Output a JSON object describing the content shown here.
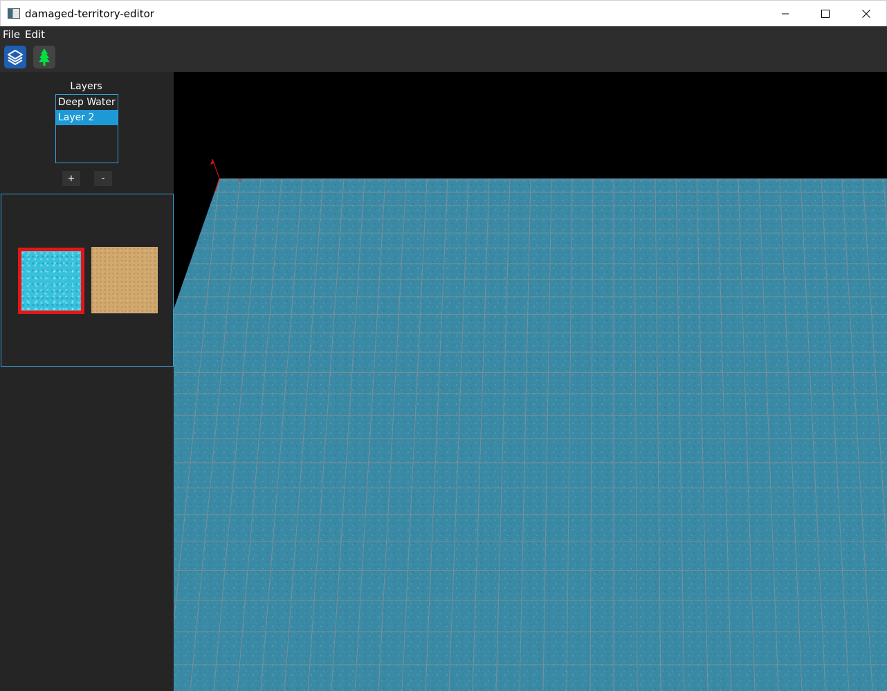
{
  "window": {
    "title": "damaged-territory-editor",
    "controls": [
      "minimize",
      "maximize",
      "close"
    ]
  },
  "menu": {
    "items": [
      {
        "label": "File"
      },
      {
        "label": "Edit"
      }
    ]
  },
  "toolbar": {
    "tools": [
      {
        "icon": "layers-icon",
        "active": true,
        "color": "#1e5fb3"
      },
      {
        "icon": "tree-icon",
        "active": false,
        "color": "#00e040"
      }
    ]
  },
  "layers_panel": {
    "title": "Layers",
    "layers": [
      {
        "label": "Deep Water",
        "selected": false
      },
      {
        "label": "Layer 2",
        "selected": true
      }
    ],
    "add_label": "+",
    "remove_label": "-"
  },
  "textures": [
    {
      "name": "water-texture",
      "selected": true,
      "color": "#36c2dd"
    },
    {
      "name": "sand-texture",
      "selected": false,
      "color": "#d1a86e"
    }
  ],
  "viewport": {
    "background": "#000000",
    "ground_color": "#3a8aa5",
    "grid_color": "#8a8f95",
    "axis_color": "#d01010"
  }
}
